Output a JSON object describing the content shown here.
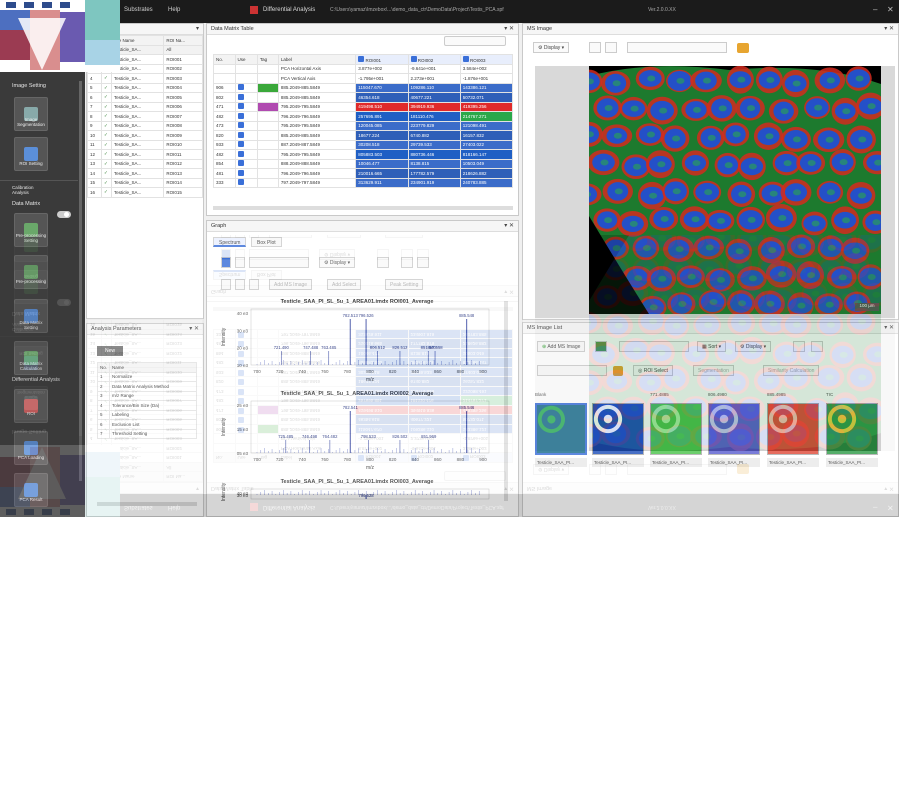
{
  "app": {
    "menu": [
      "Substrates",
      "Help"
    ],
    "title": "Differential Analysis",
    "path": "C:\\Users\\yamaz\\Imzebox\\...\\demo_data_ctr\\DemoData\\Project\\Testis_PCA.spf",
    "version": "Ver.2.0.0.XX"
  },
  "sidebar": {
    "sections": {
      "image": "Image Setting",
      "cal": "Calibration\nAnalysis",
      "dm": "Data Matrix",
      "diff": "Differential Analysis"
    },
    "buttons": {
      "img_seg": "Image\nSegmentation",
      "roi": "ROI Setting",
      "preproc_set": "Pre-processing\nSetting",
      "preproc": "Pre-processing",
      "dm_set": "Data Matrix\nSetting",
      "dm_calc": "Data Matrix\nCalculation",
      "roi2": "ROI",
      "pca_loading": "PCA Loading",
      "pca_result": "PCA Result"
    }
  },
  "file_list": {
    "headers": [
      "File Name",
      "ROI Na..."
    ],
    "rows": [
      {
        "no": "",
        "file": "Testicle_SA...",
        "roi": "All"
      },
      {
        "no": "",
        "file": "Testicle_SA...",
        "roi": "ROI001"
      },
      {
        "no": "3",
        "file": "Testicle_SA...",
        "roi": "ROI002"
      },
      {
        "no": "4",
        "file": "Testicle_SA...",
        "roi": "ROI003"
      },
      {
        "no": "5",
        "file": "Testicle_SA...",
        "roi": "ROI004"
      },
      {
        "no": "6",
        "file": "Testicle_SA...",
        "roi": "ROI005"
      },
      {
        "no": "7",
        "file": "Testicle_SA...",
        "roi": "ROI006"
      },
      {
        "no": "8",
        "file": "Testicle_SA...",
        "roi": "ROI007"
      },
      {
        "no": "9",
        "file": "Testicle_SA...",
        "roi": "ROI008"
      },
      {
        "no": "10",
        "file": "Testicle_SA...",
        "roi": "ROI009"
      },
      {
        "no": "11",
        "file": "Testicle_SA...",
        "roi": "ROI010"
      },
      {
        "no": "12",
        "file": "Testicle_SA...",
        "roi": "ROI011"
      },
      {
        "no": "13",
        "file": "Testicle_SA...",
        "roi": "ROI012"
      },
      {
        "no": "14",
        "file": "Testicle_SA...",
        "roi": "ROI013"
      },
      {
        "no": "15",
        "file": "Testicle_SA...",
        "roi": "ROI014"
      },
      {
        "no": "16",
        "file": "Testicle_SA...",
        "roi": "ROI015"
      }
    ]
  },
  "analysis": {
    "title": "Analysis Parameters",
    "new_btn": "New",
    "headers": [
      "No.",
      "Name"
    ],
    "rows": [
      [
        "1",
        "Normalize"
      ],
      [
        "2",
        "Data Matrix Analysis Method"
      ],
      [
        "3",
        "m/z Range"
      ],
      [
        "4",
        "Tolerance/Bin Size (Da)"
      ],
      [
        "5",
        "Labeling"
      ],
      [
        "6",
        "Exclusion List"
      ],
      [
        "7",
        "Threshold Setting"
      ]
    ]
  },
  "dm_table": {
    "title": "Data Matrix Table",
    "headers": [
      "No.",
      "Use",
      "Tag",
      "Label",
      "ROI001",
      "ROI002",
      "ROI003"
    ],
    "fixed_rows": [
      [
        "",
        "",
        "",
        "PCA Horizontal Axis",
        "3.877e+002",
        "-9.641e+001",
        "3.584e+002"
      ],
      [
        "",
        "",
        "",
        "PCA Vertical Axis",
        "-1.795e+001",
        "2.273e+001",
        "-1.876e+001"
      ]
    ],
    "rows": [
      [
        "906",
        "",
        "",
        "885.2049-885.5849",
        "115047.670",
        "109286.110",
        "143386.121"
      ],
      [
        "802",
        "",
        "",
        "885.2049-885.5849",
        "46354.618",
        "40677.221",
        "50732.071"
      ],
      [
        "471",
        "",
        "",
        "795.2049-795.5849",
        "419498.510",
        "394919.936",
        "419395.256"
      ],
      [
        "482",
        "",
        "",
        "796.2049-796.5849",
        "257695.891",
        "181110.476",
        "214767.271"
      ],
      [
        "473",
        "",
        "",
        "795.2049-795.5849",
        "120045.085",
        "223779.829",
        "121098.491"
      ],
      [
        "820",
        "",
        "",
        "885.2049-885.5849",
        "18677.224",
        "6740.882",
        "16157.832"
      ],
      [
        "933",
        "",
        "",
        "887.2049-887.5849",
        "30208.518",
        "29739.533",
        "27403.022"
      ],
      [
        "482",
        "",
        "",
        "795.2049-795.5849",
        "805883.503",
        "880736.446",
        "818166.147"
      ],
      [
        "854",
        "",
        "",
        "888.2049-888.5849",
        "10046.477",
        "8138.815",
        "10503.049"
      ],
      [
        "481",
        "",
        "",
        "796.2049-796.5849",
        "210016.665",
        "177782.579",
        "218626.882"
      ],
      [
        "333",
        "",
        "",
        "797.2049-797.5849",
        "313629.911",
        "234901.919",
        "240783.885"
      ]
    ]
  },
  "graph": {
    "title": "Graph",
    "tabs": [
      "Spectrum",
      "Box Plot"
    ],
    "display": "Display",
    "buttons": {
      "add_ms": "Add MS Image",
      "add_select": "Add Select",
      "peak": "Peak Setting"
    },
    "spectra": [
      {
        "title": "Testicle_SAA_PI_SL_5u_1_AREA01.imdx ROI001_Average",
        "xlabel": "m/z",
        "ylabel": "Intensity",
        "yticks": [
          "40 e3",
          "30 e3",
          "20 e3",
          "10 e3"
        ],
        "xticks": [
          "700",
          "720",
          "740",
          "760",
          "780",
          "800",
          "820",
          "840",
          "860",
          "880",
          "900"
        ],
        "peaks": [
          "721.490",
          "747.488",
          "763.485",
          "782.513",
          "796.526",
          "806.512",
          "826.512",
          "851.540",
          "857.558",
          "885.548"
        ]
      },
      {
        "title": "Testicle_SAA_PI_SL_5u_1_AREA01.imdx ROI002_Average",
        "xlabel": "m/z",
        "ylabel": "Intensity",
        "yticks": [
          "25 e3",
          "15 e3",
          "05 e3"
        ],
        "xticks": [
          "700",
          "720",
          "740",
          "760",
          "780",
          "800",
          "820",
          "840",
          "860",
          "880",
          "900"
        ],
        "peaks": [
          "725.485",
          "746.498",
          "764.482",
          "782.541",
          "798.533",
          "826.502",
          "851.969",
          "885.546"
        ]
      },
      {
        "title": "Testicle_SAA_PI_SL_5u_1_AREA01.imdx ROI003_Average",
        "xlabel": "",
        "ylabel": "Intensity",
        "yticks": [
          "40 e3",
          "30 e3"
        ],
        "xticks": [],
        "peaks": [
          "796.528"
        ]
      }
    ]
  },
  "ms_image": {
    "title": "MS Image",
    "display": "Display",
    "scale": "100 µm"
  },
  "ms_list": {
    "title": "MS Image List",
    "add_btn": "Add MS Image",
    "sort": "Sort",
    "display": "Display",
    "roi_select": "ROI Select",
    "opt1": "Segmentation",
    "opt2": "Similarity Calculation",
    "columns": [
      "Blank",
      "771.4885",
      "806.4980",
      "885.4985",
      "TIC"
    ],
    "captions": [
      "Testicle_SAA_PI...",
      "Testicle_SAA_PI...",
      "Testicle_SAA_PI...",
      "Testicle_SAA_PI...",
      "Testicle_SAA_PI...",
      "Testicle_SAA_PI..."
    ]
  },
  "colors": {
    "accent": "#3a6fd8",
    "dark_bg": "#3a3a3a",
    "title_bg": "#1b1b1b",
    "highlight_red": "#e02a2a",
    "highlight_blue": "#1f5fc4"
  }
}
